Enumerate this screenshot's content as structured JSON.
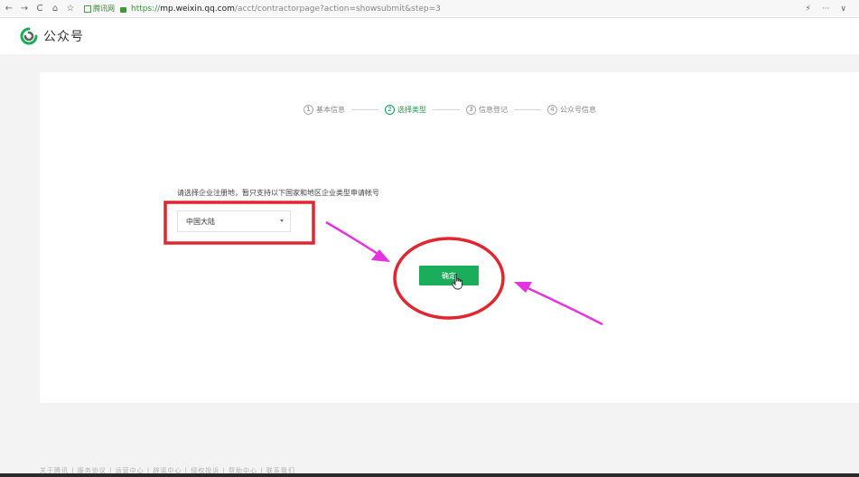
{
  "browser": {
    "back_icon": "←",
    "forward_icon": "→",
    "reload_icon": "C",
    "home_icon": "⌂",
    "star_icon": "☆",
    "site_badge": "腾讯网",
    "url_scheme": "https://",
    "url_domain": "mp.weixin.qq.com",
    "url_path": "/acct/contractorpage?action=showsubmit&step=3",
    "flash_icon": "⚡",
    "more_icon": "···",
    "dropdown_icon": "∨"
  },
  "header": {
    "logo_text": "公众号"
  },
  "steps": [
    {
      "num": "1",
      "label": "基本信息",
      "active": false
    },
    {
      "num": "2",
      "label": "选择类型",
      "active": true
    },
    {
      "num": "3",
      "label": "信息登记",
      "active": false
    },
    {
      "num": "4",
      "label": "公众号信息",
      "active": false
    }
  ],
  "form": {
    "prompt": "请选择企业注册地，暂只支持以下国家和地区企业类型申请帐号",
    "region_value": "中国大陆",
    "confirm_label": "确定"
  },
  "footer": {
    "text": "关于腾讯 | 服务协议 | 运营中心 | 辟谣中心 | 侵权投诉 | 帮助中心 | 联系我们"
  },
  "colors": {
    "accent": "#1aad5a",
    "annotation_red": "#e0262e",
    "annotation_magenta": "#e633e0"
  }
}
